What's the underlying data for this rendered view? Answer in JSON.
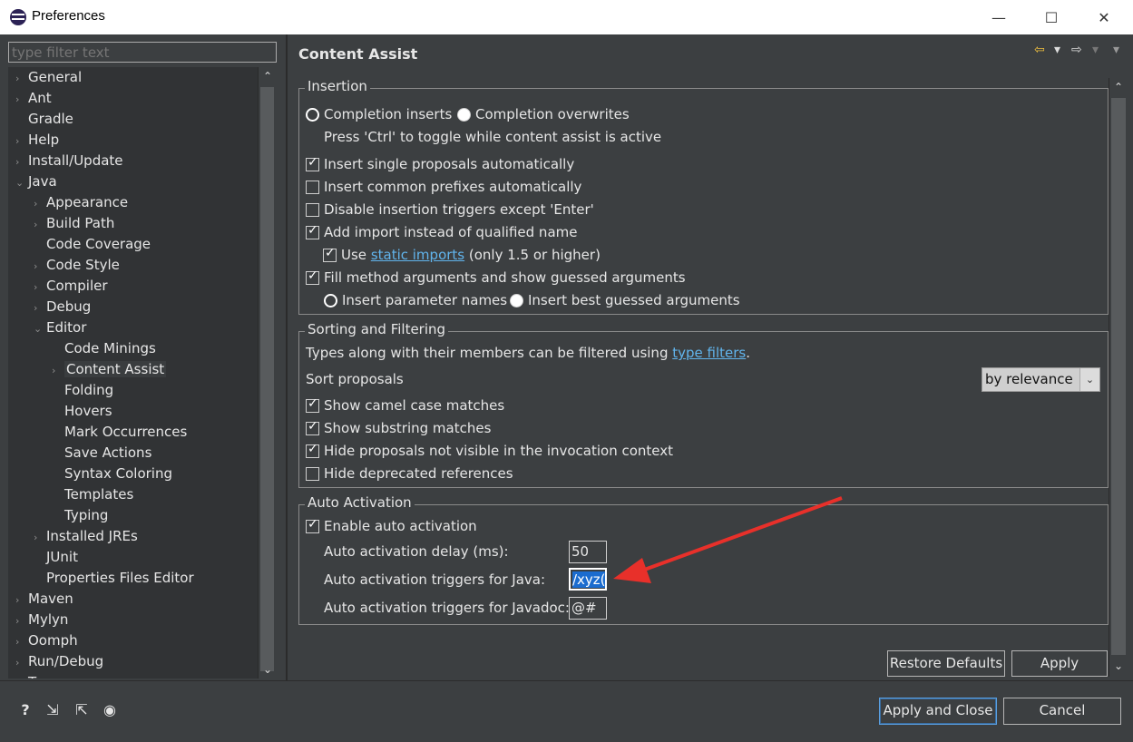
{
  "window": {
    "title": "Preferences",
    "minimize_glyph": "—",
    "maximize_glyph": "☐",
    "close_glyph": "✕"
  },
  "sidebar": {
    "filter_placeholder": "type filter text",
    "items": [
      {
        "label": "General",
        "arrow": "›"
      },
      {
        "label": "Ant",
        "arrow": "›"
      },
      {
        "label": "Gradle",
        "arrow": ""
      },
      {
        "label": "Help",
        "arrow": "›"
      },
      {
        "label": "Install/Update",
        "arrow": "›"
      },
      {
        "label": "Java",
        "arrow": "⌄"
      },
      {
        "label": "Appearance",
        "arrow": "›"
      },
      {
        "label": "Build Path",
        "arrow": "›"
      },
      {
        "label": "Code Coverage",
        "arrow": ""
      },
      {
        "label": "Code Style",
        "arrow": "›"
      },
      {
        "label": "Compiler",
        "arrow": "›"
      },
      {
        "label": "Debug",
        "arrow": "›"
      },
      {
        "label": "Editor",
        "arrow": "⌄"
      },
      {
        "label": "Code Minings",
        "arrow": ""
      },
      {
        "label": "Content Assist",
        "arrow": "›"
      },
      {
        "label": "Folding",
        "arrow": ""
      },
      {
        "label": "Hovers",
        "arrow": ""
      },
      {
        "label": "Mark Occurrences",
        "arrow": ""
      },
      {
        "label": "Save Actions",
        "arrow": ""
      },
      {
        "label": "Syntax Coloring",
        "arrow": ""
      },
      {
        "label": "Templates",
        "arrow": ""
      },
      {
        "label": "Typing",
        "arrow": ""
      },
      {
        "label": "Installed JREs",
        "arrow": "›"
      },
      {
        "label": "JUnit",
        "arrow": ""
      },
      {
        "label": "Properties Files Editor",
        "arrow": ""
      },
      {
        "label": "Maven",
        "arrow": "›"
      },
      {
        "label": "Mylyn",
        "arrow": "›"
      },
      {
        "label": "Oomph",
        "arrow": "›"
      },
      {
        "label": "Run/Debug",
        "arrow": "›"
      },
      {
        "label": "Te",
        "arrow": "›"
      }
    ]
  },
  "page": {
    "title": "Content Assist",
    "nav_back": "⇦",
    "nav_forward": "⇨",
    "nav_menu": "▾"
  },
  "insertion": {
    "title": "Insertion",
    "completion_inserts": "Completion inserts",
    "completion_overwrites": "Completion overwrites",
    "toggle_hint": "Press 'Ctrl' to toggle while content assist is active",
    "insert_single": "Insert single proposals automatically",
    "insert_common": "Insert common prefixes automatically",
    "disable_triggers": "Disable insertion triggers except 'Enter'",
    "add_import": "Add import instead of qualified name",
    "use_label": "Use",
    "static_imports": "static imports",
    "only_15": "(only 1.5 or higher)",
    "fill_method": "Fill method arguments and show guessed arguments",
    "insert_param_names": "Insert parameter names",
    "insert_best_guessed": "Insert best guessed arguments"
  },
  "sorting": {
    "title": "Sorting and Filtering",
    "types_text": "Types along with their members can be filtered using",
    "type_filters": "type filters",
    "period": ".",
    "sort_proposals": "Sort proposals",
    "sort_value": "by relevance",
    "camel_case": "Show camel case matches",
    "substring": "Show substring matches",
    "hide_not_visible": "Hide proposals not visible in the invocation context",
    "hide_deprecated": "Hide deprecated references"
  },
  "auto_activation": {
    "title": "Auto Activation",
    "enable": "Enable auto activation",
    "delay_label": "Auto activation delay (ms):",
    "delay_value": "50",
    "java_label": "Auto activation triggers for Java:",
    "java_value": "/xyz(,",
    "javadoc_label": "Auto activation triggers for Javadoc:",
    "javadoc_value": "@#"
  },
  "buttons": {
    "restore_defaults": "Restore Defaults",
    "apply": "Apply",
    "apply_and_close": "Apply and Close",
    "cancel": "Cancel"
  },
  "colors": {
    "background": "#3c3f41",
    "link": "#61b4ec",
    "annotation_arrow": "#e8302a",
    "selection": "#1b6ccf"
  }
}
